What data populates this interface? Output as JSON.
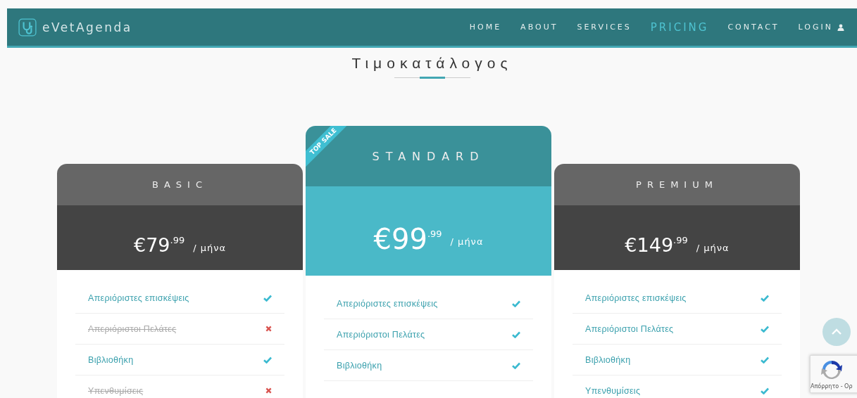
{
  "navbar": {
    "brand": "eVetAgenda",
    "items": [
      {
        "label": "HOME",
        "selected": false
      },
      {
        "label": "ABOUT",
        "selected": false
      },
      {
        "label": "SERVICES",
        "selected": false
      },
      {
        "label": "PRICING",
        "selected": true
      },
      {
        "label": "CONTACT",
        "selected": false
      },
      {
        "label": "LOGIN",
        "selected": false
      }
    ]
  },
  "heading": "Τιμοκατάλογος",
  "plans": [
    {
      "name": "BASIC",
      "featured": false,
      "price": "€79",
      "cents": ".99",
      "period": "/ μήνα",
      "features": [
        {
          "label": "Απεριόριστες επισκέψεις",
          "included": true
        },
        {
          "label": "Απεριόριστοι Πελάτες",
          "included": false
        },
        {
          "label": "Βιβλιοθήκη",
          "included": true
        },
        {
          "label": "Υπενθυμίσεις",
          "included": false
        }
      ]
    },
    {
      "name": "STANDARD",
      "featured": true,
      "ribbon": "TOP SALE",
      "price": "€99",
      "cents": ".99",
      "period": "/ μήνα",
      "features": [
        {
          "label": "Απεριόριστες επισκέψεις",
          "included": true
        },
        {
          "label": "Απεριόριστοι Πελάτες",
          "included": true
        },
        {
          "label": "Βιβλιοθήκη",
          "included": true
        }
      ]
    },
    {
      "name": "PREMIUM",
      "featured": false,
      "price": "€149",
      "cents": ".99",
      "period": "/ μήνα",
      "features": [
        {
          "label": "Απεριόριστες επισκέψεις",
          "included": true
        },
        {
          "label": "Απεριόριστοι Πελάτες",
          "included": true
        },
        {
          "label": "Βιβλιοθήκη",
          "included": true
        },
        {
          "label": "Υπενθυμίσεις",
          "included": true
        }
      ]
    }
  ],
  "recaptcha": {
    "text": "Απόρρητο - Ορ"
  }
}
